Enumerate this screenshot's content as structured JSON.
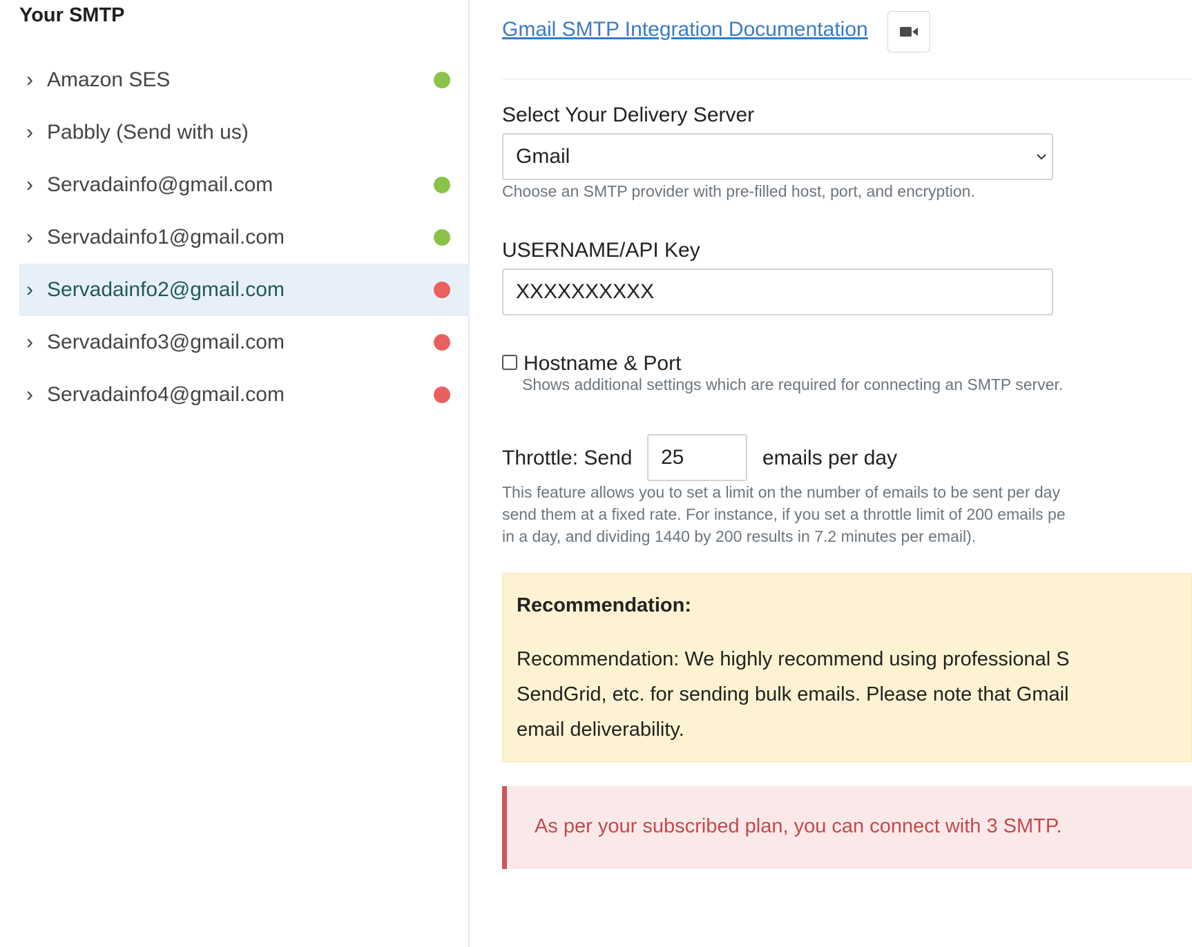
{
  "sidebar": {
    "title": "Your SMTP",
    "items": [
      {
        "label": "Amazon SES",
        "status": "connected",
        "dot_color": "#8bc34a"
      },
      {
        "label": "Pabbly (Send with us)",
        "status": "none",
        "dot_color": ""
      },
      {
        "label": "Servadainfo@gmail.com",
        "status": "connected",
        "dot_color": "#8bc34a"
      },
      {
        "label": "Servadainfo1@gmail.com",
        "status": "connected",
        "dot_color": "#8bc34a"
      },
      {
        "label": "Servadainfo2@gmail.com",
        "status": "error",
        "dot_color": "#e8615f",
        "selected": true
      },
      {
        "label": "Servadainfo3@gmail.com",
        "status": "error",
        "dot_color": "#e8615f"
      },
      {
        "label": "Servadainfo4@gmail.com",
        "status": "error",
        "dot_color": "#e8615f"
      }
    ],
    "chevron_icon": "chevron-right-icon"
  },
  "main": {
    "doc_link": "Gmail SMTP Integration Documentation",
    "video_icon": "video-camera-icon",
    "delivery_server": {
      "label": "Select Your Delivery Server",
      "value": "Gmail",
      "help": "Choose an SMTP provider with pre-filled host, port, and encryption."
    },
    "username": {
      "label": "USERNAME/API Key",
      "value": "XXXXXXXXXX"
    },
    "hostname_port": {
      "label": "Hostname & Port",
      "checked": false,
      "help": "Shows additional settings which are required for connecting an SMTP server."
    },
    "throttle": {
      "prefix": "Throttle: Send",
      "value": "25",
      "suffix": "emails per day",
      "description": [
        "This feature allows you to set a limit on the number of emails to be sent per day",
        "send them at a fixed rate. For instance, if you set a throttle limit of 200 emails pe",
        "in a day, and dividing 1440 by 200 results in 7.2 minutes per email)."
      ]
    },
    "recommendation": {
      "title": "Recommendation:",
      "lines": [
        "Recommendation: We highly recommend using professional S",
        "SendGrid, etc. for sending bulk emails. Please note that Gmail",
        "email deliverability."
      ]
    },
    "alert": "As per your subscribed plan, you can connect with 3 SMTP."
  },
  "colors": {
    "link": "#3a7bc2",
    "connected": "#8bc34a",
    "error": "#e8615f",
    "selected_bg": "#e7f0f8",
    "recommend_bg": "#fdf3d2",
    "alert_bg": "#fbe9ea",
    "alert_text": "#c24a4a"
  }
}
